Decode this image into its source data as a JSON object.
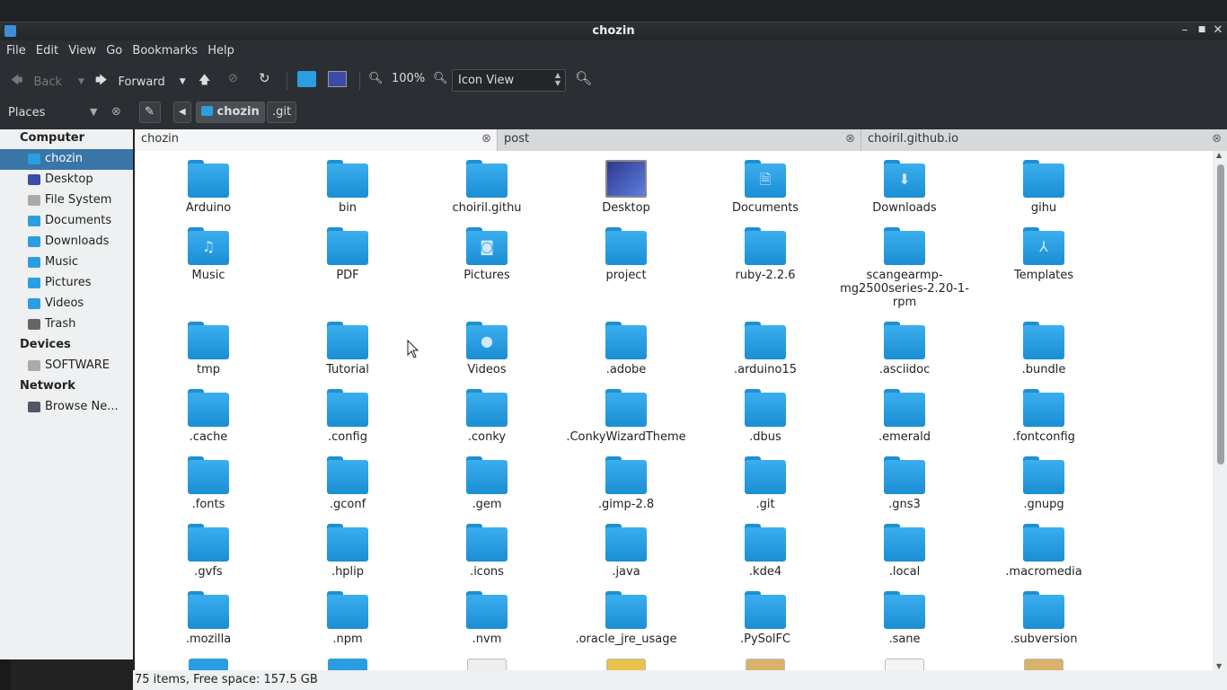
{
  "window": {
    "title": "chozin"
  },
  "menu": [
    "File",
    "Edit",
    "View",
    "Go",
    "Bookmarks",
    "Help"
  ],
  "toolbar": {
    "back_label": "Back",
    "forward_label": "Forward",
    "zoom_level": "100%",
    "view_mode": "Icon View"
  },
  "sidebar": {
    "title": "Places",
    "groups": [
      {
        "label": "Computer",
        "items": [
          "chozin",
          "Desktop",
          "File System",
          "Documents",
          "Downloads",
          "Music",
          "Pictures",
          "Videos",
          "Trash"
        ]
      },
      {
        "label": "Devices",
        "items": [
          "SOFTWARE"
        ]
      },
      {
        "label": "Network",
        "items": [
          "Browse Ne..."
        ]
      }
    ],
    "selected": "chozin"
  },
  "pathbar": [
    "chozin",
    ".git"
  ],
  "tabs": [
    "chozin",
    "post",
    "choiril.github.io"
  ],
  "files": [
    "Arduino",
    "bin",
    "choiril.githu",
    "Desktop",
    "Documents",
    "Downloads",
    "gihu",
    "Music",
    "PDF",
    "Pictures",
    "project",
    "ruby-2.2.6",
    "scangearmp-mg2500series-2.20-1-rpm",
    "Templates",
    "tmp",
    "Tutorial",
    "Videos",
    ".adobe",
    ".arduino15",
    ".asciidoc",
    ".bundle",
    ".cache",
    ".config",
    ".conky",
    ".ConkyWizardTheme",
    ".dbus",
    ".emerald",
    ".fontconfig",
    ".fonts",
    ".gconf",
    ".gem",
    ".gimp-2.8",
    ".git",
    ".gns3",
    ".gnupg",
    ".gvfs",
    ".hplip",
    ".icons",
    ".java",
    ".kde4",
    ".local",
    ".macromedia",
    ".mozilla",
    ".npm",
    ".nvm",
    ".oracle_jre_usage",
    ".PySolFC",
    ".sane",
    ".subversion"
  ],
  "status": "75 items, Free space: 157.5 GB",
  "colors": {
    "folder": "#1f8fd0",
    "selection": "#3a75a8",
    "chrome": "#2b2f33"
  }
}
